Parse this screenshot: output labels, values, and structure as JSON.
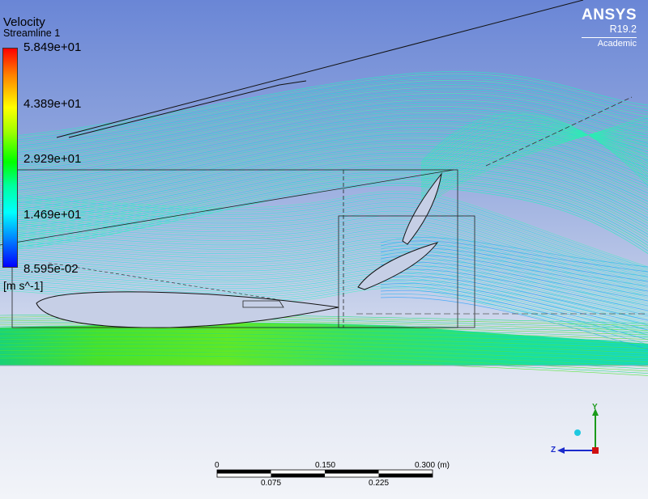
{
  "legend": {
    "title": "Velocity",
    "subtitle": "Streamline 1",
    "ticks": [
      "5.849e+01",
      "4.389e+01",
      "2.929e+01",
      "1.469e+01",
      "8.595e-02"
    ],
    "units": "[m s^-1]"
  },
  "brand": {
    "name": "ANSYS",
    "version": "R19.2",
    "edition": "Academic"
  },
  "scale_bar": {
    "top_labels": [
      "0",
      "0.150",
      "0.300"
    ],
    "unit": "(m)",
    "bottom_labels": [
      "0.075",
      "0.225"
    ]
  },
  "triad": {
    "y_label": "Y",
    "z_label": "Z",
    "y_color": "#1a9a1a",
    "z_color": "#1a2acc",
    "origin_color": "#d01010"
  },
  "colors": {
    "max": "#ff0000",
    "mid": "#00ff00",
    "min": "#0000ff"
  }
}
